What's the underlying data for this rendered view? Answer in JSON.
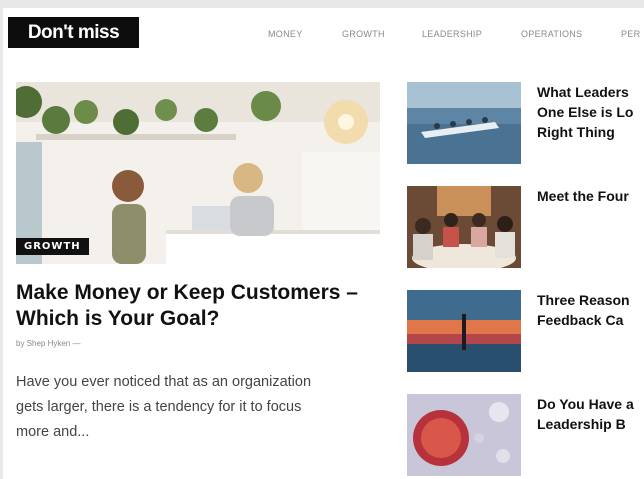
{
  "brand": {
    "label": "Don't miss"
  },
  "nav": {
    "items": [
      "MONEY",
      "GROWTH",
      "LEADERSHIP",
      "OPERATIONS",
      "PER"
    ]
  },
  "featured": {
    "category": "GROWTH",
    "title_line1": "Make Money or Keep Customers –",
    "title_line2": "Which is Your Goal?",
    "byline": "by Shep Hyken —",
    "excerpt_line1": "Have you ever noticed that as an organization",
    "excerpt_line2": "gets larger, there is a tendency for it to focus",
    "excerpt_line3": "more and..."
  },
  "articles": [
    {
      "lines": [
        "What Leaders",
        "One Else is Lo",
        "Right Thing"
      ]
    },
    {
      "lines": [
        "Meet the Four"
      ]
    },
    {
      "lines": [
        "Three Reason",
        "Feedback Ca"
      ]
    },
    {
      "lines": [
        "Do You Have a",
        "Leadership B"
      ]
    }
  ],
  "colors": {
    "brand_bg": "#0d0d0d",
    "page_bg": "#ffffff",
    "nav_text": "#8a8a8a"
  }
}
